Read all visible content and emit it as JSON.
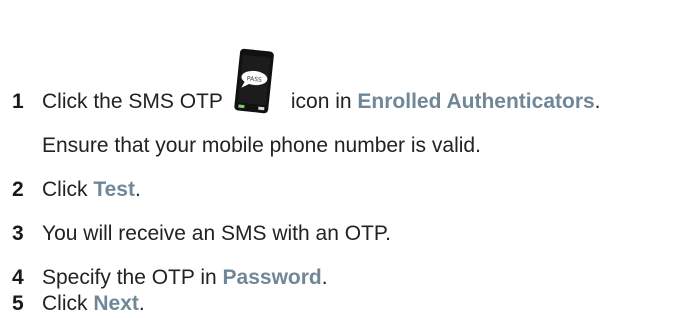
{
  "steps": [
    {
      "number": "1",
      "text_before": "Click the SMS OTP",
      "icon": "sms-otp-phone-icon",
      "text_middle": "icon in",
      "ui_label": "Enrolled Authenticators",
      "text_after": ".",
      "note": "Ensure that your mobile phone number is valid."
    },
    {
      "number": "2",
      "text_before": "Click",
      "ui_label": "Test",
      "text_after": "."
    },
    {
      "number": "3",
      "text": "You will receive an SMS with an OTP."
    },
    {
      "number": "4",
      "text_before": "Specify the OTP in",
      "ui_label": "Password",
      "text_after": "."
    },
    {
      "number": "5",
      "text_before": "Click",
      "ui_label": "Next",
      "text_after": "."
    }
  ],
  "icon_bubble_text": "PASS",
  "colors": {
    "text": "#222222",
    "ui_label": "#6f8797",
    "icon_phone": "#111111",
    "icon_bubble": "#ffffff"
  }
}
